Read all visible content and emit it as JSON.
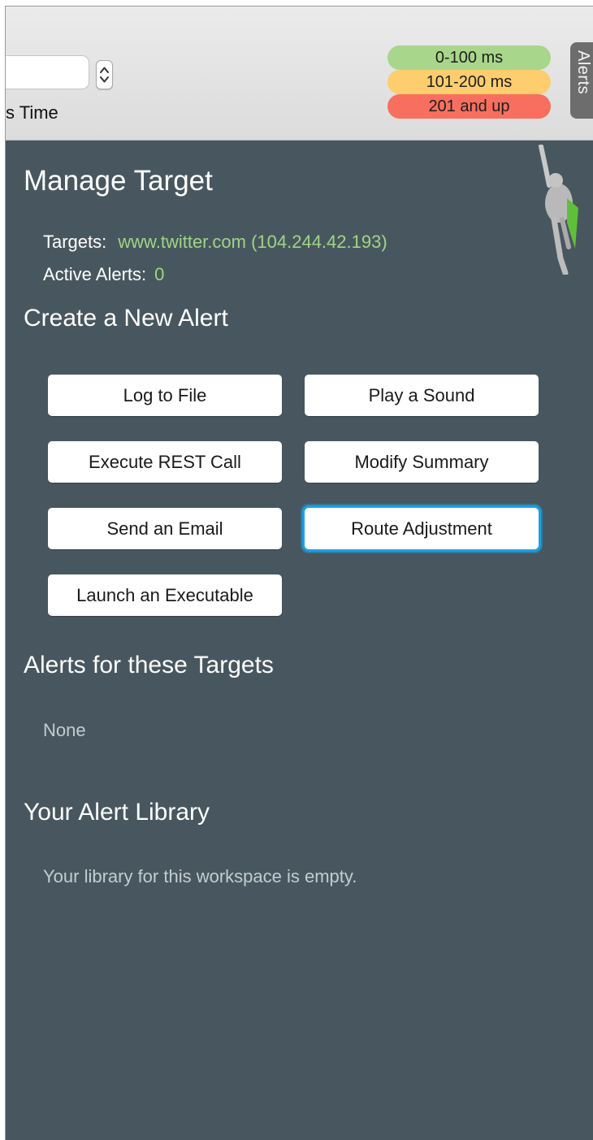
{
  "toolbar": {
    "time_label": "s Time",
    "legend": [
      {
        "label": "0-100 ms",
        "color": "#a8d68a"
      },
      {
        "label": "101-200 ms",
        "color": "#fdcd6e"
      },
      {
        "label": "201 and up",
        "color": "#f86f5f"
      }
    ],
    "alerts_tab": "Alerts"
  },
  "manage": {
    "title": "Manage Target",
    "targets_label": "Targets:",
    "targets_value": "www.twitter.com (104.244.42.193)",
    "active_alerts_label": "Active Alerts:",
    "active_alerts_value": "0"
  },
  "create": {
    "title": "Create a New Alert",
    "buttons": [
      {
        "label": "Log to File"
      },
      {
        "label": "Play a Sound"
      },
      {
        "label": "Execute REST Call"
      },
      {
        "label": "Modify Summary"
      },
      {
        "label": "Send an Email"
      },
      {
        "label": "Route Adjustment",
        "focused": true
      },
      {
        "label": "Launch an Executable"
      }
    ]
  },
  "alerts_for_targets": {
    "title": "Alerts for these Targets",
    "empty_text": "None"
  },
  "library": {
    "title": "Your Alert Library",
    "empty_text": "Your library for this workspace is empty."
  },
  "colors": {
    "panel_bg": "#48575f",
    "accent_green": "#9fd584",
    "focus_ring": "#1aa1e6"
  }
}
